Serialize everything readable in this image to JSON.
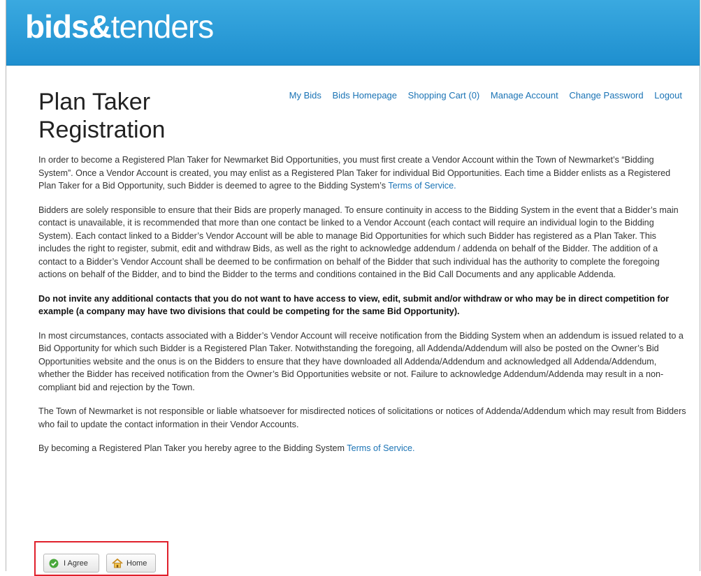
{
  "header": {
    "logo_bold": "bids",
    "logo_amp": "&",
    "logo_light": "tenders"
  },
  "page_title": "Plan Taker Registration",
  "nav": {
    "my_bids": "My Bids",
    "bids_homepage": "Bids Homepage",
    "shopping_cart": "Shopping Cart (0)",
    "manage_account": "Manage Account",
    "change_password": "Change Password",
    "logout": "Logout"
  },
  "content": {
    "p1_text": "In order to become a Registered Plan Taker for Newmarket Bid Opportunities, you must first create a Vendor Account within the Town of Newmarket’s “Bidding System”. Once a Vendor Account is created, you may enlist as a Registered Plan Taker for individual Bid Opportunities. Each time a Bidder enlists as a Registered Plan Taker for a Bid Opportunity, such Bidder is deemed to agree to the Bidding System’s ",
    "p1_link": "Terms of Service.",
    "p2": "Bidders are solely responsible to ensure that their Bids are properly managed.  To ensure continuity in access to the Bidding System in the event that a Bidder’s main contact is unavailable, it is recommended that more than one contact be linked to a Vendor Account (each contact will require an individual login to the Bidding System).  Each contact linked to a Bidder’s Vendor Account will be able to manage Bid Opportunities for which such Bidder has registered as a Plan Taker.  This includes the right to register, submit, edit and withdraw Bids, as well as the right to acknowledge addendum / addenda on behalf of the Bidder.  The addition of a contact to a Bidder’s Vendor Account shall be deemed to be confirmation on behalf of the Bidder that such individual has the authority to complete the foregoing actions on behalf of the Bidder, and to bind the Bidder to the terms and conditions contained in the Bid Call Documents and any applicable Addenda.",
    "p3": "Do not invite any additional contacts that you do not want to have access to view, edit, submit and/or withdraw or who may be in direct competition for example (a company may have two divisions that could be competing for the same Bid Opportunity).",
    "p4": "In most circumstances, contacts associated with a Bidder’s Vendor Account will receive notification from the Bidding System when an addendum is issued related to a Bid Opportunity for which such Bidder is a Registered Plan Taker.  Notwithstanding the foregoing, all Addenda/Addendum will also be posted on the Owner’s Bid Opportunities website and the onus is on the Bidders to ensure that they have downloaded all Addenda/Addendum and acknowledged all Addenda/Addendum, whether the Bidder has received notification from the Owner’s Bid Opportunities website or not.  Failure to acknowledge Addendum/Addenda may result in a non-compliant bid and rejection by the Town.",
    "p5": "The Town of Newmarket is not responsible or liable whatsoever for misdirected notices of solicitations or notices of Addenda/Addendum which may result from Bidders who fail to update the contact information in their Vendor Accounts.",
    "p6_text": "By becoming a Registered Plan Taker you hereby agree to the Bidding System ",
    "p6_link": "Terms of Service."
  },
  "buttons": {
    "agree_label": "I Agree",
    "agree_icon": "check-circle-icon",
    "home_label": "Home",
    "home_icon": "house-icon"
  },
  "colors": {
    "header_blue": "#2a9ad8",
    "link_blue": "#1a73b5",
    "highlight_red": "#e0202b",
    "check_green": "#4aa83c"
  }
}
